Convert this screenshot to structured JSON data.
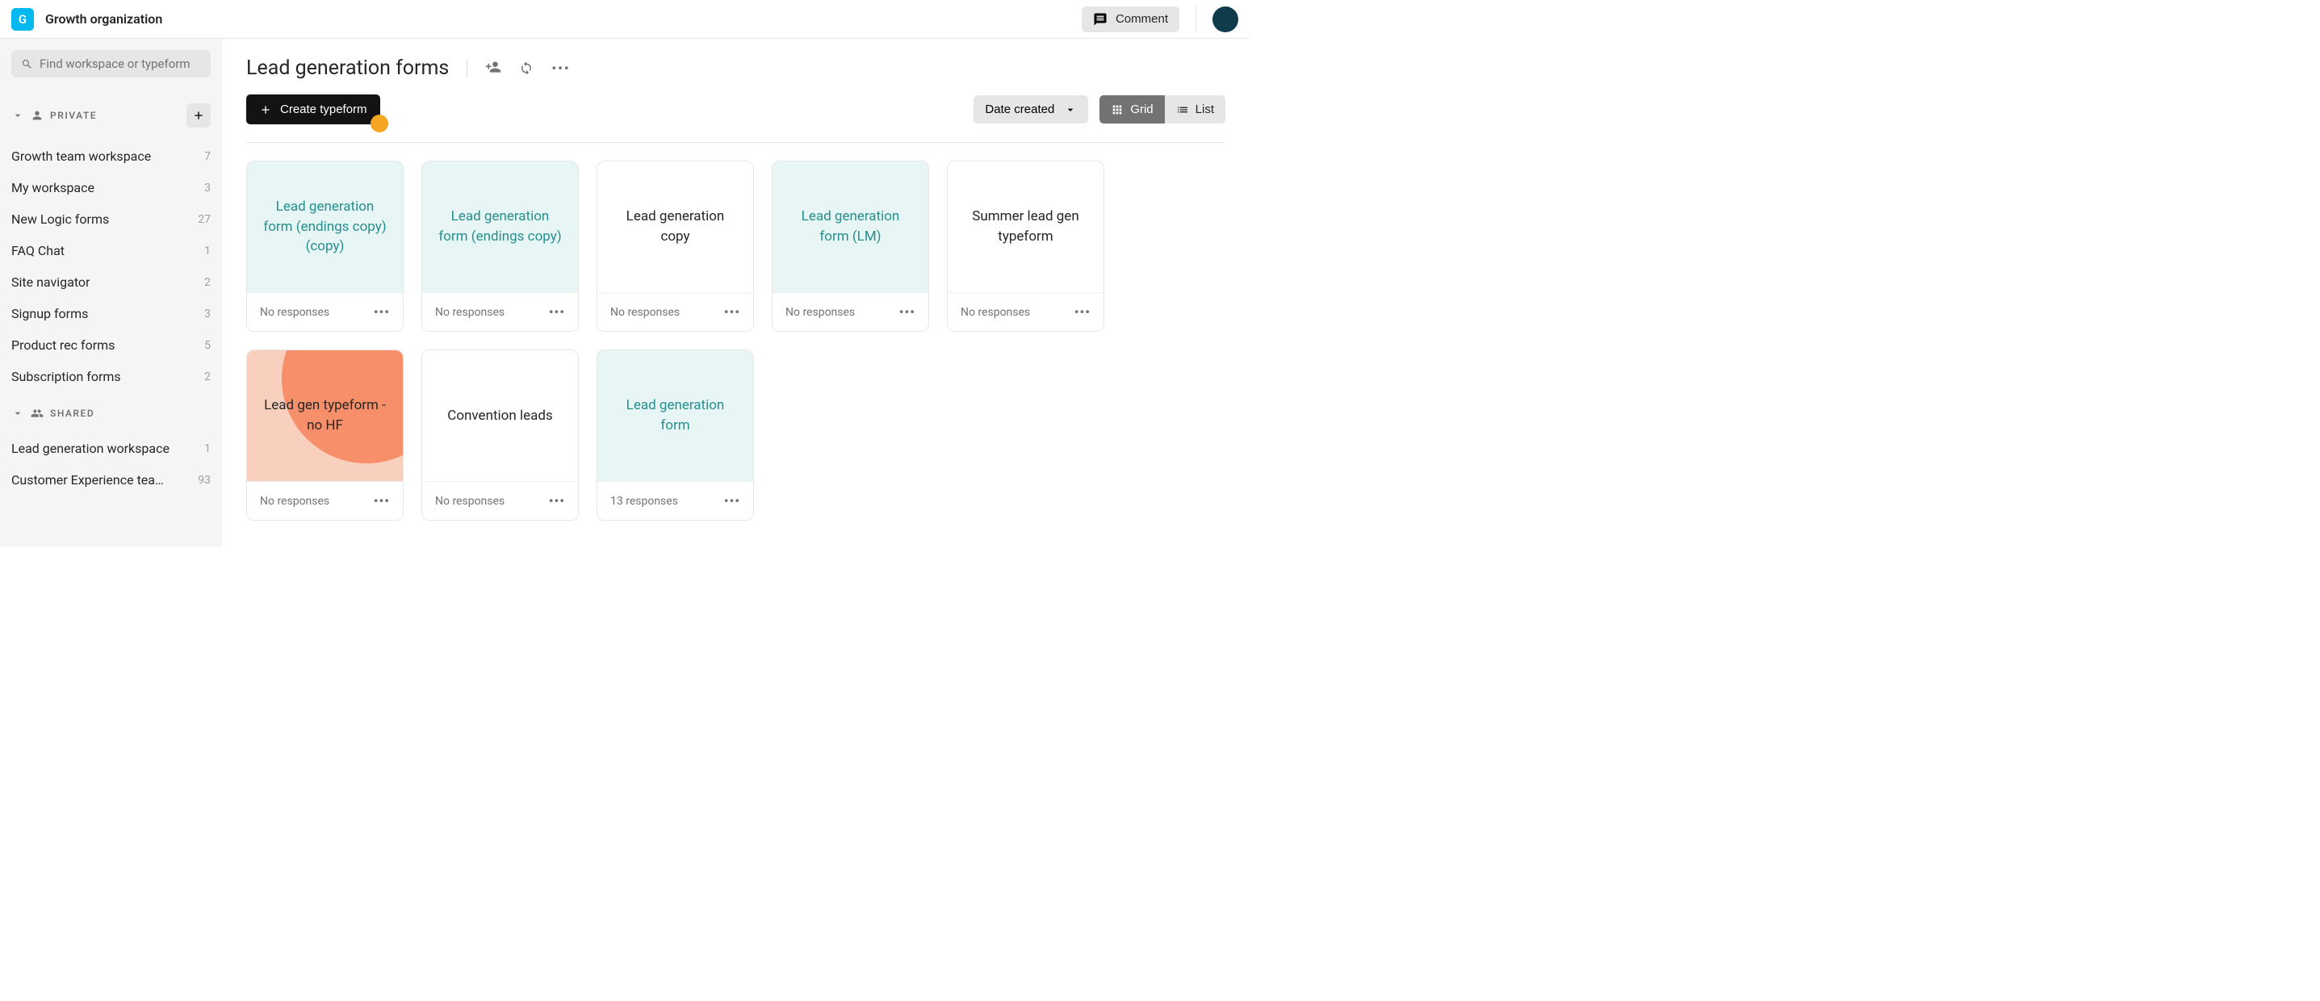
{
  "header": {
    "org_initial": "G",
    "org_name": "Growth organization",
    "comment_label": "Comment"
  },
  "sidebar": {
    "search_placeholder": "Find workspace or typeform",
    "sections": {
      "private": {
        "label": "PRIVATE"
      },
      "shared": {
        "label": "SHARED"
      }
    },
    "private_items": [
      {
        "name": "Growth team workspace",
        "count": "7"
      },
      {
        "name": "My workspace",
        "count": "3"
      },
      {
        "name": "New Logic forms",
        "count": "27"
      },
      {
        "name": "FAQ Chat",
        "count": "1"
      },
      {
        "name": "Site navigator",
        "count": "2"
      },
      {
        "name": "Signup forms",
        "count": "3"
      },
      {
        "name": "Product rec forms",
        "count": "5"
      },
      {
        "name": "Subscription forms",
        "count": "2"
      }
    ],
    "shared_items": [
      {
        "name": "Lead generation workspace",
        "count": "1"
      },
      {
        "name": "Customer Experience team …",
        "count": "93"
      }
    ]
  },
  "main": {
    "title": "Lead generation forms",
    "create_label": "Create typeform",
    "sort_label": "Date created",
    "view_grid": "Grid",
    "view_list": "List"
  },
  "cards": [
    {
      "title": "Lead generation form (endings copy) (copy)",
      "responses": "No responses",
      "theme": "teal"
    },
    {
      "title": "Lead generation form (endings copy)",
      "responses": "No responses",
      "theme": "teal"
    },
    {
      "title": "Lead generation copy",
      "responses": "No responses",
      "theme": "white"
    },
    {
      "title": "Lead generation form (LM)",
      "responses": "No responses",
      "theme": "teal"
    },
    {
      "title": "Summer lead gen typeform",
      "responses": "No responses",
      "theme": "white"
    },
    {
      "title": "Lead gen typeform - no HF",
      "responses": "No responses",
      "theme": "salmon"
    },
    {
      "title": "Convention leads",
      "responses": "No responses",
      "theme": "white"
    },
    {
      "title": "Lead generation form",
      "responses": "13 responses",
      "theme": "teal"
    }
  ]
}
